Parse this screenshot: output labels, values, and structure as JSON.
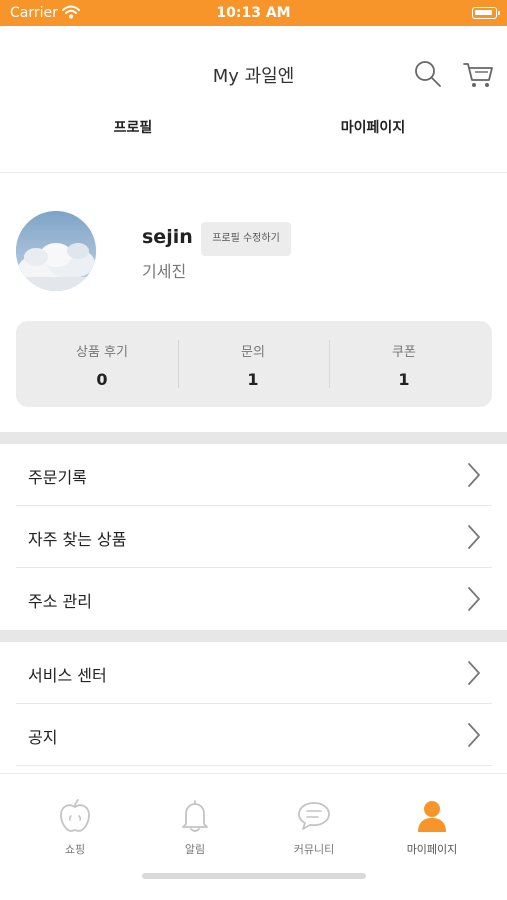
{
  "status_bar": {
    "carrier": "Carrier",
    "time": "10:13 AM"
  },
  "header": {
    "title": "My 과일엔"
  },
  "tabs": [
    {
      "label": "프로필"
    },
    {
      "label": "마이페이지"
    }
  ],
  "profile": {
    "username": "sejin",
    "real_name": "기세진",
    "edit_label": "프로필 수정하기"
  },
  "stats": [
    {
      "label": "상품 후기",
      "value": "0"
    },
    {
      "label": "문의",
      "value": "1"
    },
    {
      "label": "쿠폰",
      "value": "1"
    }
  ],
  "menu": {
    "group1": [
      {
        "label": "주문기록"
      },
      {
        "label": "자주 찾는 상품"
      },
      {
        "label": "주소 관리"
      }
    ],
    "group2": [
      {
        "label": "서비스 센터"
      },
      {
        "label": "공지"
      }
    ]
  },
  "tabbar": [
    {
      "label": "쇼핑",
      "icon": "apple-icon"
    },
    {
      "label": "알림",
      "icon": "bell-icon"
    },
    {
      "label": "커뮤니티",
      "icon": "chat-icon"
    },
    {
      "label": "마이페이지",
      "icon": "person-icon",
      "active": true
    }
  ],
  "colors": {
    "accent": "#f7942a",
    "icon_inactive": "#c4c4c4",
    "card_bg": "#ececec"
  }
}
